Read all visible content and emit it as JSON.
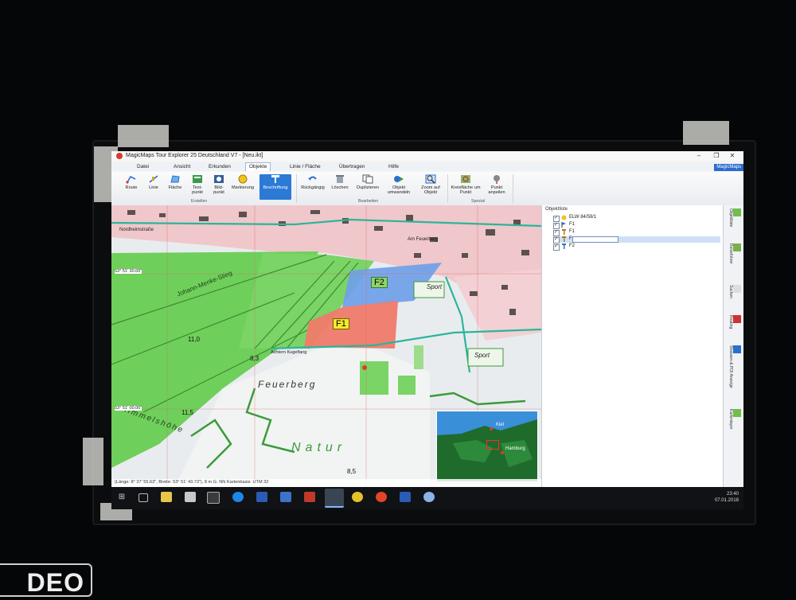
{
  "app": {
    "title": "MagicMaps Tour Explorer 25 Deutschland V7 - [Neu.ikt]",
    "magicmaps_button": "MagicMaps",
    "window_controls": [
      "–",
      "❐",
      "✕"
    ]
  },
  "menu": [
    "Datei",
    "Ansicht",
    "Erkunden",
    "Objekte",
    "Linie / Fläche",
    "Übertragen",
    "Hilfe"
  ],
  "menu_active": "Objekte",
  "ribbon": {
    "tools": [
      {
        "label": "Route",
        "icon": "route-icon"
      },
      {
        "label": "Linie",
        "icon": "line-icon"
      },
      {
        "label": "Fläche",
        "icon": "area-icon"
      },
      {
        "label": "Text-punkt",
        "icon": "textpoint-icon"
      },
      {
        "label": "Bild-punkt",
        "icon": "imagepoint-icon"
      },
      {
        "label": "Markierung",
        "icon": "marker-icon"
      },
      {
        "label": "Beschriftung",
        "icon": "label-icon"
      },
      {
        "label": "Rückgängig",
        "icon": "undo-icon"
      },
      {
        "label": "Löschen",
        "icon": "delete-icon"
      },
      {
        "label": "Duplizieren",
        "icon": "duplicate-icon"
      },
      {
        "label": "Objekt umwandeln",
        "icon": "convert-icon"
      },
      {
        "label": "Zoom auf Objekt",
        "icon": "zoom-object-icon"
      },
      {
        "label": "Kreisfläche um Punkt",
        "icon": "circle-area-icon"
      },
      {
        "label": "Punkt anpeilen",
        "icon": "point-bearing-icon"
      }
    ],
    "groups": [
      "Erstellen",
      "Bearbeiten",
      "Spezial"
    ]
  },
  "map": {
    "area_f1": "F1",
    "area_f2": "F2",
    "labels": {
      "street1": "Nordheimstraße",
      "street2": "Am Feuerberg",
      "street3": "Achtern Kugelfang",
      "street4": "Johann-Menke-Stieg",
      "sport1": "Sport",
      "sport2": "Sport",
      "place1": "Feuerberg",
      "place2": "Himmelshöhe",
      "nature": "Natur",
      "coord1": "53° 51' 30.00\"",
      "coord2": "53° 51' 00.00\"",
      "elev1": "11,0",
      "elev2": "8,3",
      "elev3": "11,5",
      "elev4": "8,5"
    },
    "overview": {
      "city1": "Kiel",
      "city2": "Hamburg"
    },
    "status": "(Länge: 8° 37' 55.63\", Breite: 53° 51' 43.73\"), 8 m G. NN   Kartenbasis: UTM 32"
  },
  "object_list": {
    "title": "Objektliste",
    "items": [
      {
        "label": "ELW 84/59/1",
        "icon": "marker-icon"
      },
      {
        "label": "F1",
        "icon": "flag-icon"
      },
      {
        "label": "F1",
        "icon": "label-icon"
      },
      {
        "label": "F",
        "icon": "label-icon",
        "editing": true
      },
      {
        "label": "F2",
        "icon": "label-icon"
      }
    ]
  },
  "side_tabs": [
    "Objektliste",
    "Reiseführer",
    "Suchen",
    "Routing",
    "Strassen & POI Anzeige",
    "Kartenlayer"
  ],
  "taskbar": {
    "time": "23:40",
    "date": "07.01.2018"
  },
  "overlay_text": "DEO",
  "colors": {
    "accent": "#2b7ad6",
    "forest": "#6fcf5b",
    "urban": "#f2c6c8",
    "f1_fill": "#f07a6a",
    "f2_fill": "#6fa0e8",
    "road": "#2bb59a"
  }
}
